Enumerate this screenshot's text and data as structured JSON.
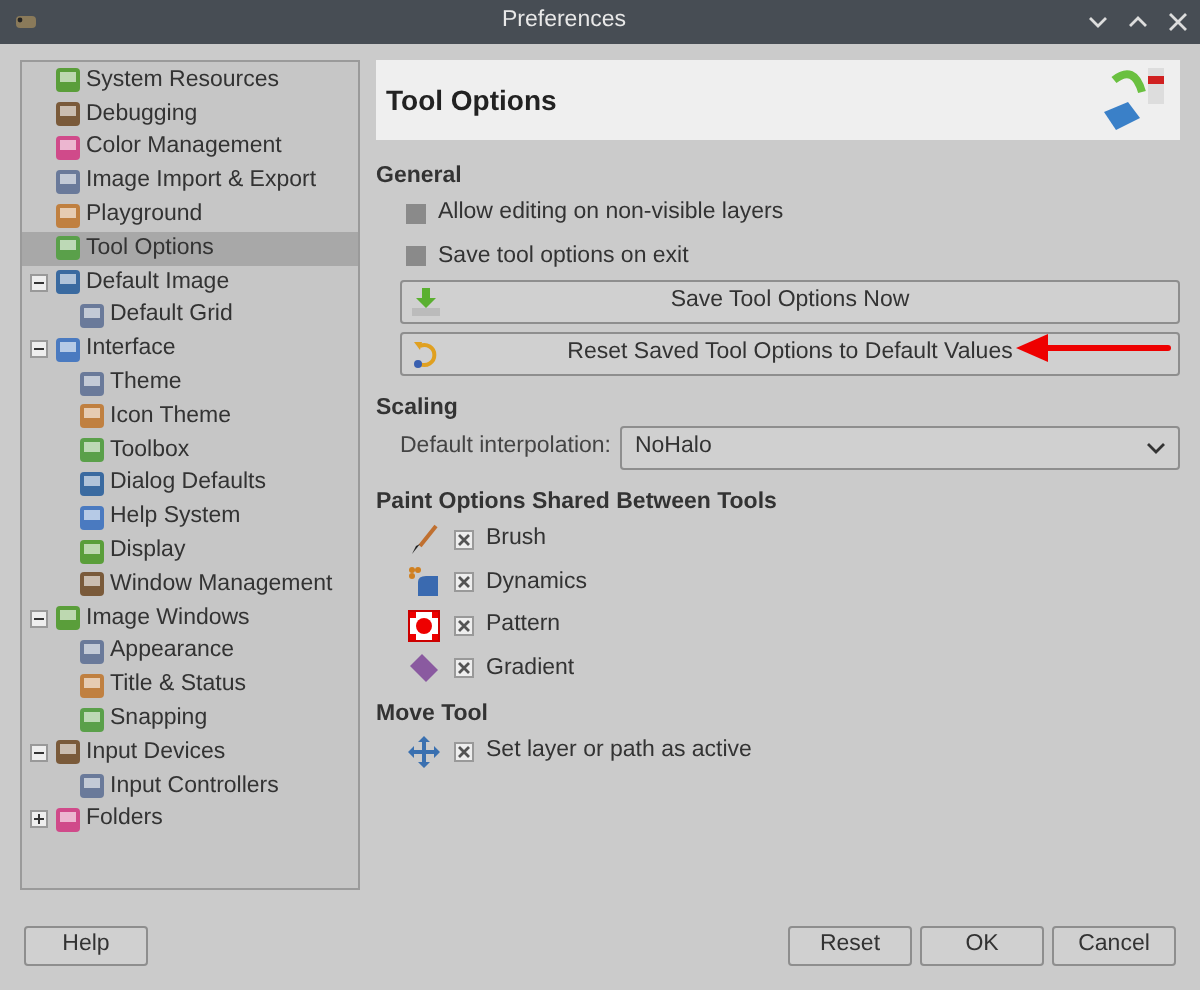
{
  "window": {
    "title": "Preferences"
  },
  "sidebar": {
    "items": [
      {
        "label": "System Resources",
        "selected": false
      },
      {
        "label": "Debugging",
        "selected": false
      },
      {
        "label": "Color Management",
        "selected": false
      },
      {
        "label": "Image Import & Export",
        "selected": false
      },
      {
        "label": "Playground",
        "selected": false
      },
      {
        "label": "Tool Options",
        "selected": true
      },
      {
        "label": "Default Image",
        "selected": false,
        "expanded": true,
        "children": [
          {
            "label": "Default Grid",
            "selected": false
          }
        ]
      },
      {
        "label": "Interface",
        "selected": false,
        "expanded": true,
        "children": [
          {
            "label": "Theme",
            "selected": false
          },
          {
            "label": "Icon Theme",
            "selected": false
          },
          {
            "label": "Toolbox",
            "selected": false
          },
          {
            "label": "Dialog Defaults",
            "selected": false
          },
          {
            "label": "Help System",
            "selected": false
          },
          {
            "label": "Display",
            "selected": false
          },
          {
            "label": "Window Management",
            "selected": false
          }
        ]
      },
      {
        "label": "Image Windows",
        "selected": false,
        "expanded": true,
        "children": [
          {
            "label": "Appearance",
            "selected": false
          },
          {
            "label": "Title & Status",
            "selected": false
          },
          {
            "label": "Snapping",
            "selected": false
          }
        ]
      },
      {
        "label": "Input Devices",
        "selected": false,
        "expanded": true,
        "children": [
          {
            "label": "Input Controllers",
            "selected": false
          }
        ]
      },
      {
        "label": "Folders",
        "selected": false,
        "expanded": false
      }
    ]
  },
  "page": {
    "title": "Tool Options",
    "general": {
      "heading": "General",
      "options": [
        {
          "label": "Allow editing on non-visible layers",
          "checked": false
        },
        {
          "label": "Save tool options on exit",
          "checked": false
        }
      ],
      "buttons": [
        "Save Tool Options Now",
        "Reset Saved Tool Options to Default Values"
      ]
    },
    "scaling": {
      "heading": "Scaling",
      "label": "Default interpolation:",
      "value": "NoHalo"
    },
    "paint_options": {
      "heading": "Paint Options Shared Between Tools",
      "options": [
        {
          "kind": "brush",
          "label": "Brush",
          "checked": true
        },
        {
          "kind": "dynamics",
          "label": "Dynamics",
          "checked": true
        },
        {
          "kind": "pattern",
          "label": "Pattern",
          "checked": true
        },
        {
          "kind": "gradient",
          "label": "Gradient",
          "checked": true
        }
      ]
    },
    "move_tool": {
      "heading": "Move Tool",
      "options": [
        {
          "kind": "move",
          "label": "Set layer or path as active",
          "checked": true
        }
      ]
    }
  },
  "footer": {
    "buttons": [
      "Help",
      "Reset",
      "OK",
      "Cancel"
    ]
  }
}
